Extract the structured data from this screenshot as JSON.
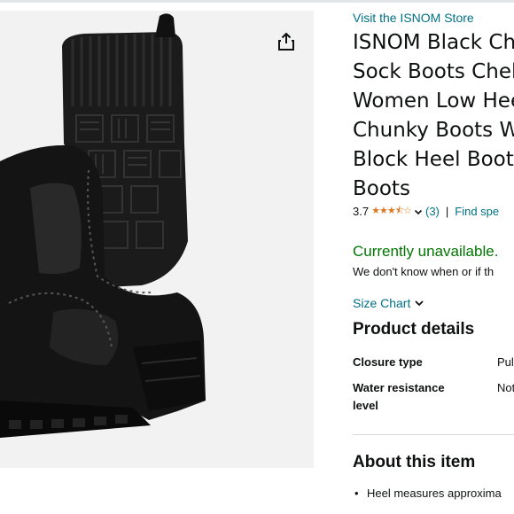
{
  "store_link": "Visit the ISNOM Store",
  "title_lines": [
    "ISNOM Black Chelsea",
    "Sock Boots Chelsea",
    "Women Low Heel",
    "Chunky Boots Women",
    "Block Heel Boots",
    "Boots"
  ],
  "rating": {
    "value": "3.7",
    "stars": 3.7,
    "review_count": "(3)",
    "separator": "|",
    "find_link": "Find spe"
  },
  "availability": {
    "status": "Currently unavailable.",
    "note": "We don't know when or if th"
  },
  "size_chart": "Size Chart",
  "product_details": {
    "heading": "Product details",
    "rows": [
      {
        "key": "Closure type",
        "value": "Pul"
      },
      {
        "key": "Water resistance level",
        "value": "Not"
      }
    ]
  },
  "about": {
    "heading": "About this item",
    "bullets": [
      "Heel measures approxima"
    ]
  },
  "colors": {
    "link": "#007185",
    "available": "#007600",
    "star": "#de7921",
    "text": "#0f1111"
  },
  "icons": {
    "share": "share-icon",
    "chevron": "chevron-down-icon",
    "image": "product-image"
  }
}
